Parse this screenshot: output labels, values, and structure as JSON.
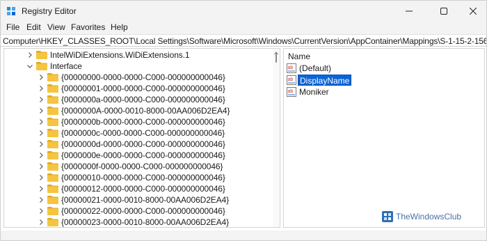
{
  "window": {
    "title": "Registry Editor"
  },
  "menu": {
    "items": [
      "File",
      "Edit",
      "View",
      "Favorites",
      "Help"
    ]
  },
  "address": {
    "path": "Computer\\HKEY_CLASSES_ROOT\\Local Settings\\Software\\Microsoft\\Windows\\CurrentVersion\\AppContainer\\Mappings\\S-1-15-2-1564618566-20"
  },
  "tree": {
    "items": [
      {
        "label": "IntelWiDiExtensions.WiDiExtensions.1",
        "expanded": false
      },
      {
        "label": "Interface",
        "expanded": true
      },
      {
        "label": "{00000000-0000-0000-C000-000000000046}",
        "expanded": false
      },
      {
        "label": "{00000001-0000-0000-C000-000000000046}",
        "expanded": false
      },
      {
        "label": "{0000000a-0000-0000-C000-000000000046}",
        "expanded": false
      },
      {
        "label": "{0000000A-0000-0010-8000-00AA006D2EA4}",
        "expanded": false
      },
      {
        "label": "{0000000b-0000-0000-C000-000000000046}",
        "expanded": false
      },
      {
        "label": "{0000000c-0000-0000-C000-000000000046}",
        "expanded": false
      },
      {
        "label": "{0000000d-0000-0000-C000-000000000046}",
        "expanded": false
      },
      {
        "label": "{0000000e-0000-0000-C000-000000000046}",
        "expanded": false
      },
      {
        "label": "{0000000f-0000-0000-C000-000000000046}",
        "expanded": false
      },
      {
        "label": "{00000010-0000-0000-C000-000000000046}",
        "expanded": false
      },
      {
        "label": "{00000012-0000-0000-C000-000000000046}",
        "expanded": false
      },
      {
        "label": "{00000021-0000-0010-8000-00AA006D2EA4}",
        "expanded": false
      },
      {
        "label": "{00000022-0000-0000-C000-000000000046}",
        "expanded": false
      },
      {
        "label": "{00000023-0000-0010-8000-00AA006D2EA4}",
        "expanded": false
      }
    ]
  },
  "values": {
    "column_header": "Name",
    "items": [
      {
        "name": "(Default)",
        "selected": false
      },
      {
        "name": "DisplayName",
        "selected": true
      },
      {
        "name": "Moniker",
        "selected": false
      }
    ],
    "icon": "string-value-ab-icon"
  },
  "watermark": {
    "text": "TheWindowsClub"
  },
  "colors": {
    "selection": "#0a64d6",
    "folder": "#f5c542",
    "titlebar": "#f3f3f3"
  }
}
